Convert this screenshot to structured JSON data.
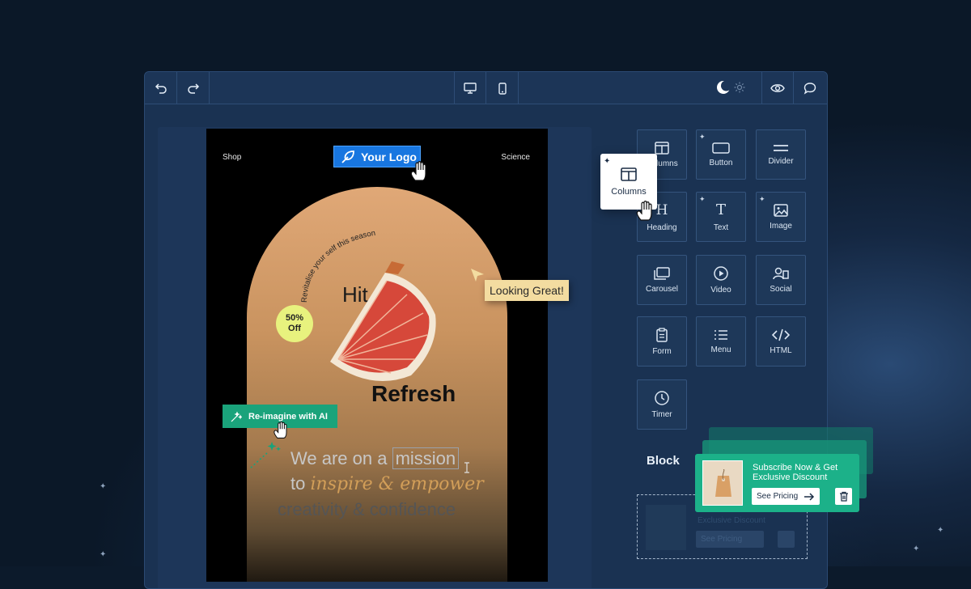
{
  "email": {
    "nav_left": "Shop",
    "nav_right": "Science",
    "logo_text": "Your Logo",
    "arch_caption": "Revitalise your self this season",
    "hit": "Hit",
    "refresh": "Refresh",
    "discount_value": "50%",
    "discount_unit": "Off",
    "mission_line1_a": "We are on a",
    "mission_line1_b": "mission",
    "mission_line2_a": "to",
    "mission_line2_b": "inspire & empower",
    "mission_line3": "creativity & confidence"
  },
  "panel": {
    "tiles": [
      {
        "label": "Columns",
        "icon": "columns-icon"
      },
      {
        "label": "Button",
        "icon": "button-icon"
      },
      {
        "label": "Divider",
        "icon": "divider-icon"
      },
      {
        "label": "Heading",
        "icon": "heading-icon"
      },
      {
        "label": "Text",
        "icon": "text-icon"
      },
      {
        "label": "Image",
        "icon": "image-icon"
      },
      {
        "label": "Carousel",
        "icon": "carousel-icon"
      },
      {
        "label": "Video",
        "icon": "video-icon"
      },
      {
        "label": "Social",
        "icon": "social-icon"
      },
      {
        "label": "Form",
        "icon": "form-icon"
      },
      {
        "label": "Menu",
        "icon": "menu-icon"
      },
      {
        "label": "HTML",
        "icon": "code-icon"
      },
      {
        "label": "Timer",
        "icon": "timer-icon"
      }
    ],
    "block_label": "Block",
    "ghost_title": "Exclusive Discount",
    "ghost_cta": "See Pricing"
  },
  "floating": {
    "columns_label": "Columns",
    "looking_great": "Looking Great!",
    "reimagine": "Re-imagine with AI"
  },
  "promo": {
    "title": "Subscribe Now & Get Exclusive Discount",
    "cta": "See Pricing"
  },
  "colors": {
    "background": "#0b1828",
    "window": "#1a3252",
    "logo_blue": "#1876e0",
    "ai_green": "#1aa37b",
    "promo_green": "#1cb189",
    "badge_yellow": "#e8f27e",
    "tooltip_yellow": "#f3dca0"
  }
}
